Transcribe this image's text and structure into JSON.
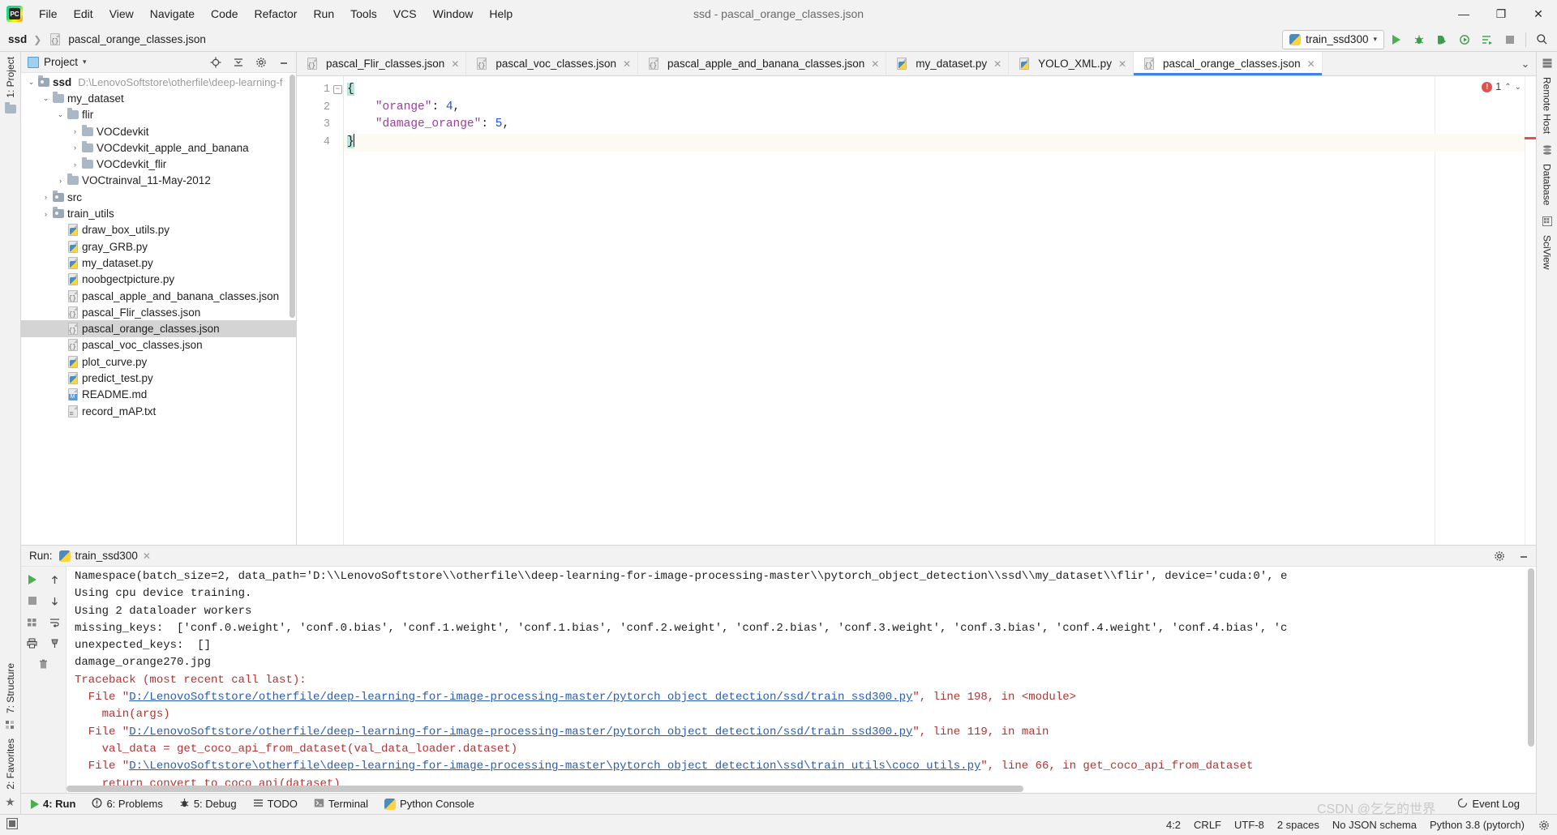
{
  "window": {
    "title": "ssd - pascal_orange_classes.json",
    "logo_text": "PC",
    "minimize": "—",
    "maximize": "❐",
    "close": "✕"
  },
  "menu": [
    {
      "label": "File"
    },
    {
      "label": "Edit"
    },
    {
      "label": "View"
    },
    {
      "label": "Navigate"
    },
    {
      "label": "Code"
    },
    {
      "label": "Refactor"
    },
    {
      "label": "Run"
    },
    {
      "label": "Tools"
    },
    {
      "label": "VCS"
    },
    {
      "label": "Window"
    },
    {
      "label": "Help"
    }
  ],
  "navbar": {
    "breadcrumb": [
      {
        "label": "ssd",
        "bold": true
      },
      {
        "label": "pascal_orange_classes.json",
        "bold": false
      }
    ],
    "separator": "❯",
    "run_config": "train_ssd300",
    "run_config_caret": "▾",
    "buttons": [
      {
        "name": "run-button",
        "glyph": "▶"
      },
      {
        "name": "debug-button",
        "glyph": "🐞"
      },
      {
        "name": "run-with-coverage-button",
        "glyph": "◗"
      },
      {
        "name": "profile-button",
        "glyph": "◔"
      },
      {
        "name": "run-dashboard-button",
        "glyph": "☰"
      },
      {
        "name": "stop-button",
        "glyph": "■"
      },
      {
        "name": "search-everywhere-button",
        "glyph": "🔍"
      }
    ]
  },
  "left_strip": [
    {
      "label": "1: Project",
      "name": "sidebar-tab-project"
    },
    {
      "label": "7: Structure",
      "name": "sidebar-tab-structure"
    },
    {
      "label": "2: Favorites",
      "name": "sidebar-tab-favorites"
    }
  ],
  "right_strip": [
    {
      "label": "Remote Host",
      "name": "sidebar-tab-remote-host"
    },
    {
      "label": "Database",
      "name": "sidebar-tab-database"
    },
    {
      "label": "SciView",
      "name": "sidebar-tab-sciview"
    }
  ],
  "project_pane": {
    "title": "Project",
    "caret": "▾",
    "actions": [
      {
        "name": "locate-icon",
        "glyph": "⊕"
      },
      {
        "name": "collapse-all-icon",
        "glyph": "⇥"
      },
      {
        "name": "settings-gear-icon",
        "glyph": "⚙"
      },
      {
        "name": "hide-icon",
        "glyph": "—"
      }
    ],
    "tree": [
      {
        "indent": 0,
        "arrow": "⌄",
        "icon": "folder-mod",
        "label": "ssd",
        "bold": true,
        "path": "D:\\LenovoSoftstore\\otherfile\\deep-learning-f",
        "selected": false
      },
      {
        "indent": 1,
        "arrow": "⌄",
        "icon": "folder",
        "label": "my_dataset",
        "bold": false,
        "path": "",
        "selected": false
      },
      {
        "indent": 2,
        "arrow": "⌄",
        "icon": "folder",
        "label": "flir",
        "bold": false,
        "path": "",
        "selected": false
      },
      {
        "indent": 3,
        "arrow": "›",
        "icon": "folder",
        "label": "VOCdevkit",
        "bold": false,
        "path": "",
        "selected": false
      },
      {
        "indent": 3,
        "arrow": "›",
        "icon": "folder",
        "label": "VOCdevkit_apple_and_banana",
        "bold": false,
        "path": "",
        "selected": false
      },
      {
        "indent": 3,
        "arrow": "›",
        "icon": "folder",
        "label": "VOCdevkit_flir",
        "bold": false,
        "path": "",
        "selected": false
      },
      {
        "indent": 2,
        "arrow": "›",
        "icon": "folder",
        "label": "VOCtrainval_11-May-2012",
        "bold": false,
        "path": "",
        "selected": false
      },
      {
        "indent": 1,
        "arrow": "›",
        "icon": "folder-mod",
        "label": "src",
        "bold": false,
        "path": "",
        "selected": false
      },
      {
        "indent": 1,
        "arrow": "›",
        "icon": "folder-mod",
        "label": "train_utils",
        "bold": false,
        "path": "",
        "selected": false
      },
      {
        "indent": 2,
        "arrow": "",
        "icon": "py",
        "label": "draw_box_utils.py",
        "bold": false,
        "path": "",
        "selected": false
      },
      {
        "indent": 2,
        "arrow": "",
        "icon": "py",
        "label": "gray_GRB.py",
        "bold": false,
        "path": "",
        "selected": false
      },
      {
        "indent": 2,
        "arrow": "",
        "icon": "py",
        "label": "my_dataset.py",
        "bold": false,
        "path": "",
        "selected": false
      },
      {
        "indent": 2,
        "arrow": "",
        "icon": "py",
        "label": "noobgectpicture.py",
        "bold": false,
        "path": "",
        "selected": false
      },
      {
        "indent": 2,
        "arrow": "",
        "icon": "json",
        "label": "pascal_apple_and_banana_classes.json",
        "bold": false,
        "path": "",
        "selected": false
      },
      {
        "indent": 2,
        "arrow": "",
        "icon": "json",
        "label": "pascal_Flir_classes.json",
        "bold": false,
        "path": "",
        "selected": false
      },
      {
        "indent": 2,
        "arrow": "",
        "icon": "json",
        "label": "pascal_orange_classes.json",
        "bold": false,
        "path": "",
        "selected": true
      },
      {
        "indent": 2,
        "arrow": "",
        "icon": "json",
        "label": "pascal_voc_classes.json",
        "bold": false,
        "path": "",
        "selected": false
      },
      {
        "indent": 2,
        "arrow": "",
        "icon": "py",
        "label": "plot_curve.py",
        "bold": false,
        "path": "",
        "selected": false
      },
      {
        "indent": 2,
        "arrow": "",
        "icon": "py",
        "label": "predict_test.py",
        "bold": false,
        "path": "",
        "selected": false
      },
      {
        "indent": 2,
        "arrow": "",
        "icon": "md",
        "label": "README.md",
        "bold": false,
        "path": "",
        "selected": false
      },
      {
        "indent": 2,
        "arrow": "",
        "icon": "txt",
        "label": "record_mAP.txt",
        "bold": false,
        "path": "",
        "selected": false
      }
    ]
  },
  "editor": {
    "tabs": [
      {
        "label": "pascal_Flir_classes.json",
        "icon": "json",
        "active": false
      },
      {
        "label": "pascal_voc_classes.json",
        "icon": "json",
        "active": false
      },
      {
        "label": "pascal_apple_and_banana_classes.json",
        "icon": "json",
        "active": false
      },
      {
        "label": "my_dataset.py",
        "icon": "py",
        "active": false
      },
      {
        "label": "YOLO_XML.py",
        "icon": "py",
        "active": false
      },
      {
        "label": "pascal_orange_classes.json",
        "icon": "json",
        "active": true
      }
    ],
    "tab_close_glyph": "✕",
    "tab_list_glyph": "⌄",
    "line_numbers": [
      "1",
      "2",
      "3",
      "4"
    ],
    "lines": [
      {
        "segments": [
          {
            "t": "{",
            "c": "brace"
          }
        ]
      },
      {
        "segments": [
          {
            "t": "    ",
            "c": "punct"
          },
          {
            "t": "\"orange\"",
            "c": "key"
          },
          {
            "t": ": ",
            "c": "punct"
          },
          {
            "t": "4",
            "c": "num"
          },
          {
            "t": ",",
            "c": "punct"
          }
        ]
      },
      {
        "segments": [
          {
            "t": "    ",
            "c": "punct"
          },
          {
            "t": "\"damage_orange\"",
            "c": "key"
          },
          {
            "t": ": ",
            "c": "punct"
          },
          {
            "t": "5",
            "c": "num"
          },
          {
            "t": ",",
            "c": "punct"
          }
        ]
      },
      {
        "segments": [
          {
            "t": "}",
            "c": "brace"
          }
        ]
      }
    ],
    "inspection": {
      "error_count": "1",
      "up_glyph": "⌃",
      "down_glyph": "⌄"
    },
    "fold_glyph": "−"
  },
  "run_pane": {
    "title": "Run:",
    "tab_label": "train_ssd300",
    "tab_close": "✕",
    "actions": [
      {
        "name": "rerun-icon",
        "glyph": "▶"
      },
      {
        "name": "stop-icon",
        "glyph": "■"
      },
      {
        "name": "scroll-up-icon",
        "glyph": "↑"
      },
      {
        "name": "scroll-down-icon",
        "glyph": "↓"
      },
      {
        "name": "print-icon",
        "glyph": "🖶"
      },
      {
        "name": "soft-wrap-icon",
        "glyph": "⇥"
      },
      {
        "name": "pin-icon",
        "glyph": "📌"
      },
      {
        "name": "clear-all-icon",
        "glyph": "🗑"
      },
      {
        "name": "settings-gear-icon",
        "glyph": "⚙"
      },
      {
        "name": "hide-icon",
        "glyph": "—"
      }
    ],
    "console_lines": [
      {
        "segments": [
          {
            "t": "Namespace(batch_size=2, data_path='D:\\\\LenovoSoftstore\\\\otherfile\\\\deep-learning-for-image-processing-master\\\\pytorch_object_detection\\\\ssd\\\\my_dataset\\\\flir', device='cuda:0', e",
            "c": "black"
          }
        ]
      },
      {
        "segments": [
          {
            "t": "Using cpu device training.",
            "c": "black"
          }
        ]
      },
      {
        "segments": [
          {
            "t": "Using 2 dataloader workers",
            "c": "black"
          }
        ]
      },
      {
        "segments": [
          {
            "t": "missing_keys:  ['conf.0.weight', 'conf.0.bias', 'conf.1.weight', 'conf.1.bias', 'conf.2.weight', 'conf.2.bias', 'conf.3.weight', 'conf.3.bias', 'conf.4.weight', 'conf.4.bias', 'c",
            "c": "black"
          }
        ]
      },
      {
        "segments": [
          {
            "t": "unexpected_keys:  []",
            "c": "black"
          }
        ]
      },
      {
        "segments": [
          {
            "t": "damage_orange270.jpg",
            "c": "black"
          }
        ]
      },
      {
        "segments": [
          {
            "t": "Traceback (most recent call last):",
            "c": "red"
          }
        ]
      },
      {
        "segments": [
          {
            "t": "  File \"",
            "c": "red"
          },
          {
            "t": "D:/LenovoSoftstore/otherfile/deep-learning-for-image-processing-master/pytorch_object_detection/ssd/train_ssd300.py",
            "c": "link"
          },
          {
            "t": "\", line 198, in <module>",
            "c": "red"
          }
        ]
      },
      {
        "segments": [
          {
            "t": "    main(args)",
            "c": "red"
          }
        ]
      },
      {
        "segments": [
          {
            "t": "  File \"",
            "c": "red"
          },
          {
            "t": "D:/LenovoSoftstore/otherfile/deep-learning-for-image-processing-master/pytorch_object_detection/ssd/train_ssd300.py",
            "c": "link"
          },
          {
            "t": "\", line 119, in main",
            "c": "red"
          }
        ]
      },
      {
        "segments": [
          {
            "t": "    val_data = get_coco_api_from_dataset(val_data_loader.dataset)",
            "c": "red"
          }
        ]
      },
      {
        "segments": [
          {
            "t": "  File \"",
            "c": "red"
          },
          {
            "t": "D:\\LenovoSoftstore\\otherfile\\deep-learning-for-image-processing-master\\pytorch_object_detection\\ssd\\train_utils\\coco_utils.py",
            "c": "link"
          },
          {
            "t": "\", line 66, in get_coco_api_from_dataset",
            "c": "red"
          }
        ]
      },
      {
        "segments": [
          {
            "t": "    return convert_to_coco_api(dataset)",
            "c": "red"
          }
        ]
      }
    ]
  },
  "bottom_bar": {
    "items": [
      {
        "label": "4: Run",
        "icon": "▶",
        "name": "tool-window-run",
        "active": true
      },
      {
        "label": "6: Problems",
        "icon": "!",
        "name": "tool-window-problems",
        "active": false
      },
      {
        "label": "5: Debug",
        "icon": "🐞",
        "name": "tool-window-debug",
        "active": false
      },
      {
        "label": "TODO",
        "icon": "☰",
        "name": "tool-window-todo",
        "active": false
      },
      {
        "label": "Terminal",
        "icon": "▣",
        "name": "tool-window-terminal",
        "active": false
      },
      {
        "label": "Python Console",
        "icon": "🐍",
        "name": "tool-window-python-console",
        "active": false
      }
    ],
    "event_log": {
      "label": "Event Log",
      "icon": "◔"
    }
  },
  "status_bar": {
    "caret_position": "4:2",
    "line_separator": "CRLF",
    "encoding": "UTF-8",
    "indent": "2 spaces",
    "schema": "No JSON schema",
    "interpreter": "Python 3.8 (pytorch)",
    "gear": "⚙"
  },
  "watermark": "CSDN @乞乞的世界"
}
